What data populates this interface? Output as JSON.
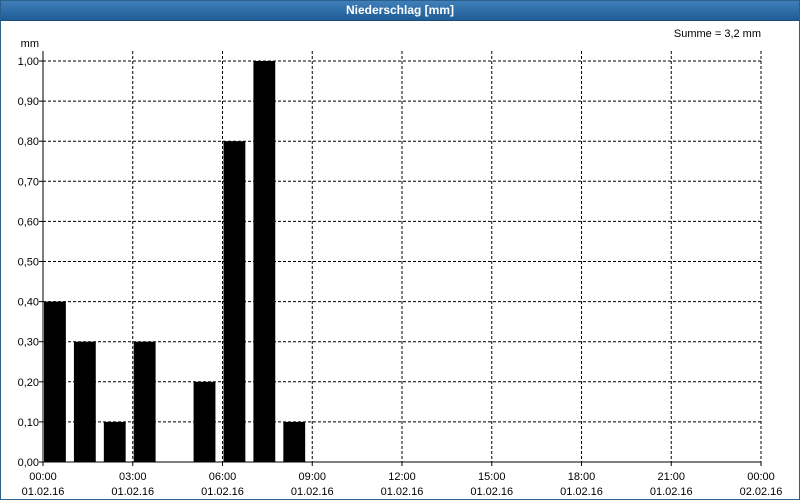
{
  "window": {
    "title": "Niederschlag [mm]"
  },
  "chart_data": {
    "type": "bar",
    "unit": "mm",
    "summary": "Summe = 3,2 mm",
    "y_ticks": [
      "0,00",
      "0,10",
      "0,20",
      "0,30",
      "0,40",
      "0,50",
      "0,60",
      "0,70",
      "0,80",
      "0,90",
      "1,00"
    ],
    "ylim": [
      0,
      1.0
    ],
    "x_ticks": [
      {
        "time": "00:00",
        "date": "01.02.16"
      },
      {
        "time": "03:00",
        "date": "01.02.16"
      },
      {
        "time": "06:00",
        "date": "01.02.16"
      },
      {
        "time": "09:00",
        "date": "01.02.16"
      },
      {
        "time": "12:00",
        "date": "01.02.16"
      },
      {
        "time": "15:00",
        "date": "01.02.16"
      },
      {
        "time": "18:00",
        "date": "01.02.16"
      },
      {
        "time": "21:00",
        "date": "01.02.16"
      },
      {
        "time": "00:00",
        "date": "02.02.16"
      }
    ],
    "categories": [
      "00:00",
      "01:00",
      "02:00",
      "03:00",
      "04:00",
      "05:00",
      "06:00",
      "07:00",
      "08:00"
    ],
    "values": [
      0.4,
      0.3,
      0.1,
      0.3,
      0.0,
      0.2,
      0.8,
      1.0,
      0.1
    ],
    "grid": true,
    "bar_color": "#000000"
  }
}
